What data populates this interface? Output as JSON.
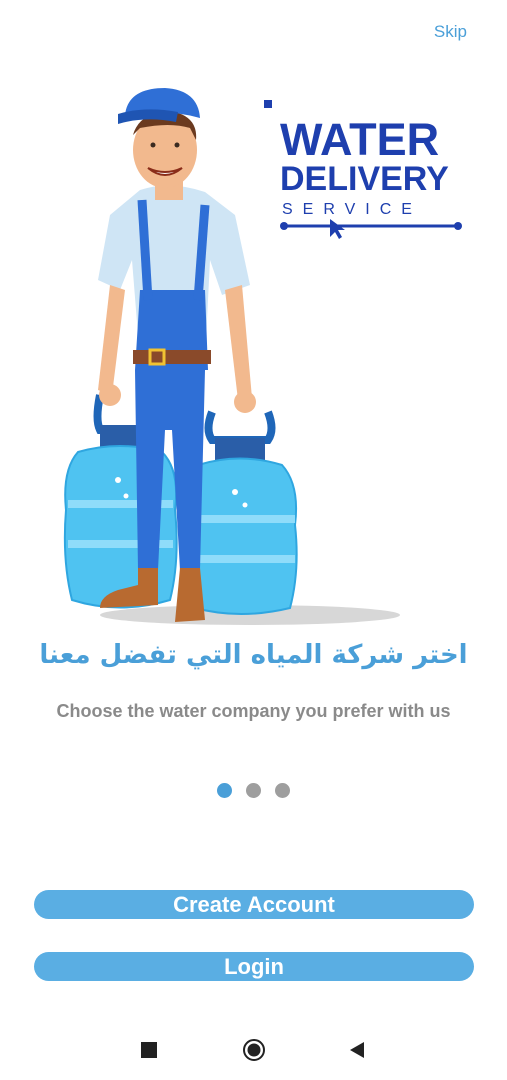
{
  "header": {
    "skip_label": "Skip"
  },
  "illustration": {
    "logo_word1": "WATER",
    "logo_word2": "DELIVERY",
    "logo_word3": "SERVICE"
  },
  "onboarding": {
    "title_ar": "اختر شركة المياه التي تفضل معنا",
    "subtitle": "Choose the water company you prefer with us",
    "page_count": 3,
    "active_page": 1
  },
  "actions": {
    "create_account_label": "Create Account",
    "login_label": "Login"
  },
  "colors": {
    "accent": "#4a9fd8",
    "button": "#5aaee3",
    "logo_blue": "#1e3fae",
    "inactive_dot": "#9e9e9e"
  },
  "system_nav": {
    "items": [
      "recents-icon",
      "home-icon",
      "back-icon"
    ]
  }
}
